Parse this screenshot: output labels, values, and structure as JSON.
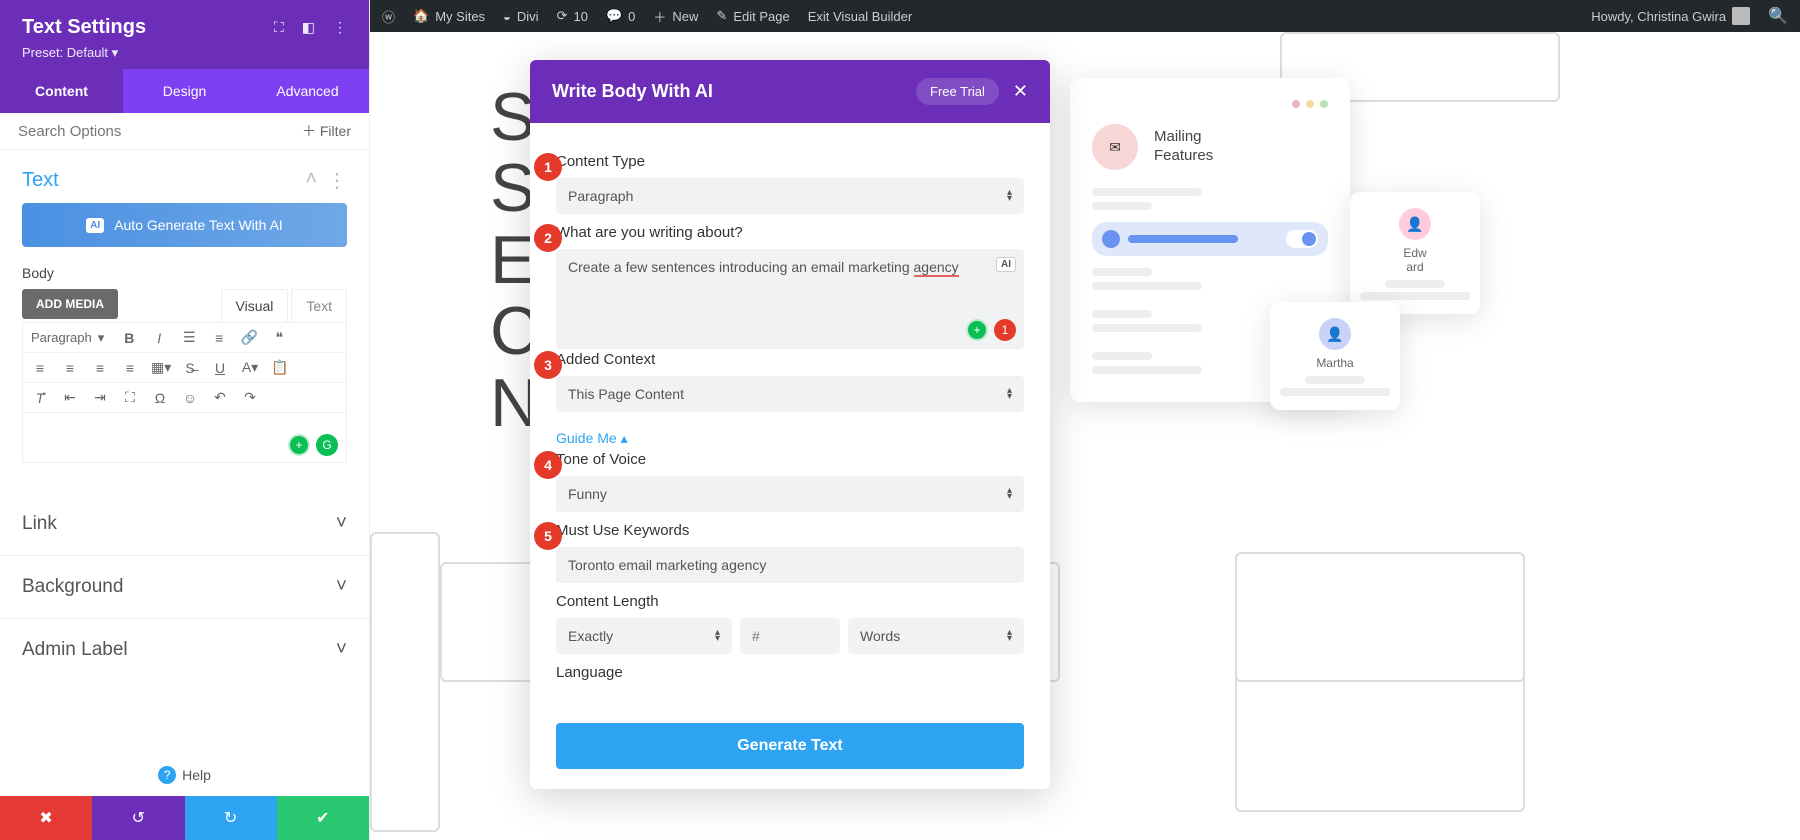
{
  "wpbar": {
    "my_sites": "My Sites",
    "divi": "Divi",
    "updates": "10",
    "comments": "0",
    "new": "New",
    "edit_page": "Edit Page",
    "exit_vb": "Exit Visual Builder",
    "howdy": "Howdy, Christina Gwira"
  },
  "sidebar": {
    "title": "Text Settings",
    "preset": "Preset: Default",
    "tabs": {
      "content": "Content",
      "design": "Design",
      "advanced": "Advanced"
    },
    "search_placeholder": "Search Options",
    "filter": "Filter",
    "text_section": "Text",
    "auto_gen": "Auto Generate Text With AI",
    "ai_badge": "AI",
    "body_label": "Body",
    "add_media": "ADD MEDIA",
    "editor_tabs": {
      "visual": "Visual",
      "text": "Text"
    },
    "paragraph_sel": "Paragraph",
    "acc": {
      "link": "Link",
      "background": "Background",
      "admin": "Admin Label"
    },
    "help": "Help"
  },
  "aimodal": {
    "title": "Write Body With AI",
    "free_trial": "Free Trial",
    "labels": {
      "content_type": "Content Type",
      "about": "What are you writing about?",
      "added_context": "Added Context",
      "tone": "Tone of Voice",
      "keywords": "Must Use Keywords",
      "length": "Content Length",
      "language": "Language"
    },
    "values": {
      "content_type": "Paragraph",
      "about_pre": "Create a few sentences introducing an email marketing ",
      "about_uword": "agency",
      "added_context": "This Page Content",
      "tone": "Funny",
      "keywords": "Toronto email marketing agency",
      "length_mode": "Exactly",
      "length_num": "#",
      "length_unit": "Words"
    },
    "guide": "Guide Me",
    "error_badge": "1",
    "generate": "Generate Text",
    "steps": [
      "1",
      "2",
      "3",
      "4",
      "5"
    ]
  },
  "mock": {
    "mailing": "Mailing",
    "features": "Features",
    "edward": "Edw\nard",
    "martha": "Martha"
  },
  "bg_letters": "S\nS\nE\nC\nN"
}
